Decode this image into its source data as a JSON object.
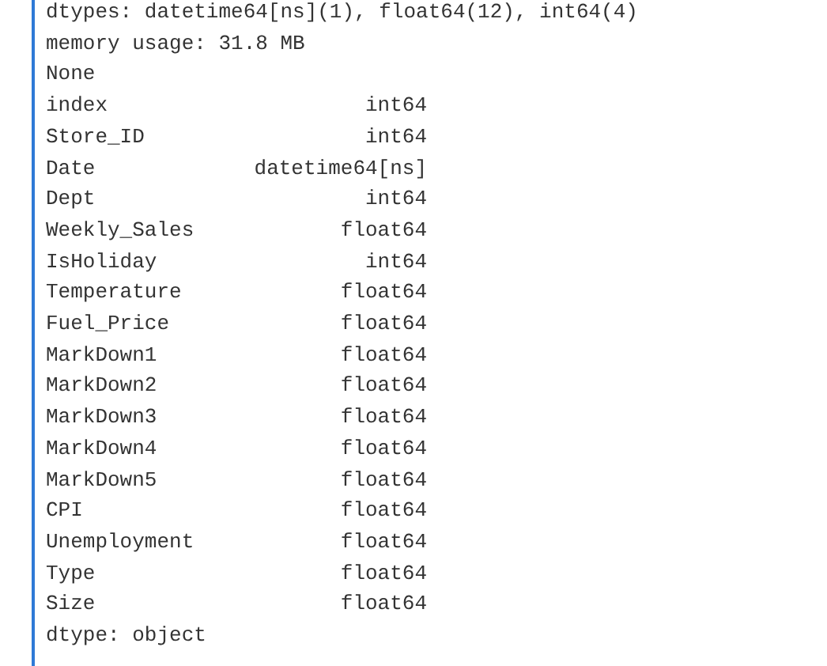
{
  "header_lines": [
    "dtypes: datetime64[ns](1), float64(12), int64(4)",
    "memory usage: 31.8 MB",
    "None"
  ],
  "dtype_rows": [
    {
      "name": "index",
      "dtype": "int64"
    },
    {
      "name": "Store_ID",
      "dtype": "int64"
    },
    {
      "name": "Date",
      "dtype": "datetime64[ns]"
    },
    {
      "name": "Dept",
      "dtype": "int64"
    },
    {
      "name": "Weekly_Sales",
      "dtype": "float64"
    },
    {
      "name": "IsHoliday",
      "dtype": "int64"
    },
    {
      "name": "Temperature",
      "dtype": "float64"
    },
    {
      "name": "Fuel_Price",
      "dtype": "float64"
    },
    {
      "name": "MarkDown1",
      "dtype": "float64"
    },
    {
      "name": "MarkDown2",
      "dtype": "float64"
    },
    {
      "name": "MarkDown3",
      "dtype": "float64"
    },
    {
      "name": "MarkDown4",
      "dtype": "float64"
    },
    {
      "name": "MarkDown5",
      "dtype": "float64"
    },
    {
      "name": "CPI",
      "dtype": "float64"
    },
    {
      "name": "Unemployment",
      "dtype": "float64"
    },
    {
      "name": "Type",
      "dtype": "float64"
    },
    {
      "name": "Size",
      "dtype": "float64"
    }
  ],
  "footer_line": "dtype: object"
}
